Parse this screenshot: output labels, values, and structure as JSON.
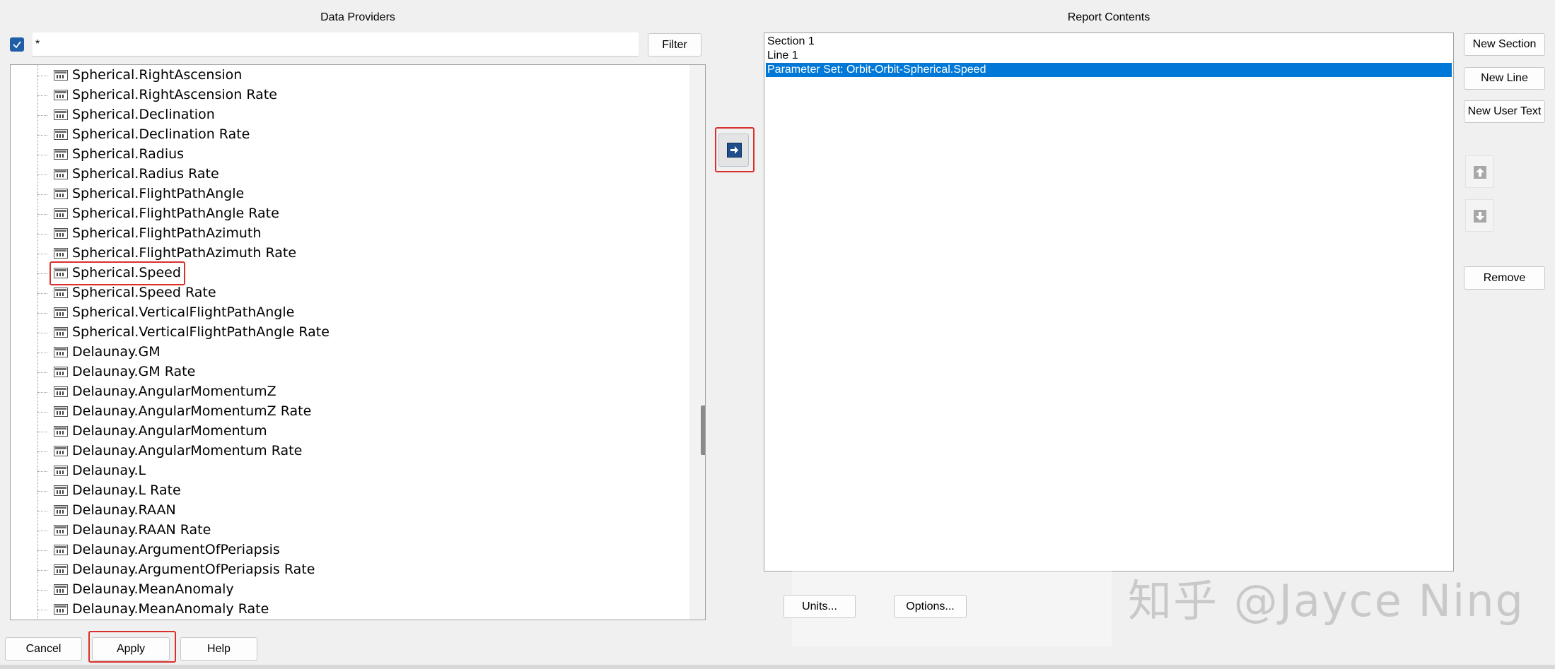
{
  "data_providers": {
    "title": "Data Providers",
    "filter_value": "*",
    "filter_button": "Filter",
    "items": [
      {
        "label": "Spherical.RightAscension",
        "highlighted": false
      },
      {
        "label": "Spherical.RightAscension Rate",
        "highlighted": false
      },
      {
        "label": "Spherical.Declination",
        "highlighted": false
      },
      {
        "label": "Spherical.Declination Rate",
        "highlighted": false
      },
      {
        "label": "Spherical.Radius",
        "highlighted": false
      },
      {
        "label": "Spherical.Radius Rate",
        "highlighted": false
      },
      {
        "label": "Spherical.FlightPathAngle",
        "highlighted": false
      },
      {
        "label": "Spherical.FlightPathAngle Rate",
        "highlighted": false
      },
      {
        "label": "Spherical.FlightPathAzimuth",
        "highlighted": false
      },
      {
        "label": "Spherical.FlightPathAzimuth Rate",
        "highlighted": false
      },
      {
        "label": "Spherical.Speed",
        "highlighted": true
      },
      {
        "label": "Spherical.Speed Rate",
        "highlighted": false
      },
      {
        "label": "Spherical.VerticalFlightPathAngle",
        "highlighted": false
      },
      {
        "label": "Spherical.VerticalFlightPathAngle Rate",
        "highlighted": false
      },
      {
        "label": "Delaunay.GM",
        "highlighted": false
      },
      {
        "label": "Delaunay.GM Rate",
        "highlighted": false
      },
      {
        "label": "Delaunay.AngularMomentumZ",
        "highlighted": false
      },
      {
        "label": "Delaunay.AngularMomentumZ Rate",
        "highlighted": false
      },
      {
        "label": "Delaunay.AngularMomentum",
        "highlighted": false
      },
      {
        "label": "Delaunay.AngularMomentum Rate",
        "highlighted": false
      },
      {
        "label": "Delaunay.L",
        "highlighted": false
      },
      {
        "label": "Delaunay.L Rate",
        "highlighted": false
      },
      {
        "label": "Delaunay.RAAN",
        "highlighted": false
      },
      {
        "label": "Delaunay.RAAN Rate",
        "highlighted": false
      },
      {
        "label": "Delaunay.ArgumentOfPeriapsis",
        "highlighted": false
      },
      {
        "label": "Delaunay.ArgumentOfPeriapsis Rate",
        "highlighted": false
      },
      {
        "label": "Delaunay.MeanAnomaly",
        "highlighted": false
      },
      {
        "label": "Delaunay.MeanAnomaly Rate",
        "highlighted": false
      }
    ]
  },
  "report_contents": {
    "title": "Report Contents",
    "items": [
      {
        "label": "Section 1",
        "selected": false
      },
      {
        "label": "Line 1",
        "selected": false
      },
      {
        "label": "Parameter Set: Orbit-Orbit-Spherical.Speed",
        "selected": true
      }
    ]
  },
  "side_buttons": {
    "new_section": "New Section",
    "new_line": "New Line",
    "new_user_text": "New User Text",
    "remove": "Remove"
  },
  "bottom": {
    "units": "Units...",
    "options": "Options...",
    "cancel": "Cancel",
    "apply": "Apply",
    "help": "Help"
  },
  "watermark": "知乎 @Jayce Ning",
  "colors": {
    "selection": "#0078d7",
    "highlight_outline": "#d9302c",
    "accent": "#1f5fa8"
  },
  "icons": {
    "add_arrow": "arrow-right-icon",
    "move_up": "arrow-up-icon",
    "move_down": "arrow-down-icon",
    "parameter": "parameter-icon"
  }
}
